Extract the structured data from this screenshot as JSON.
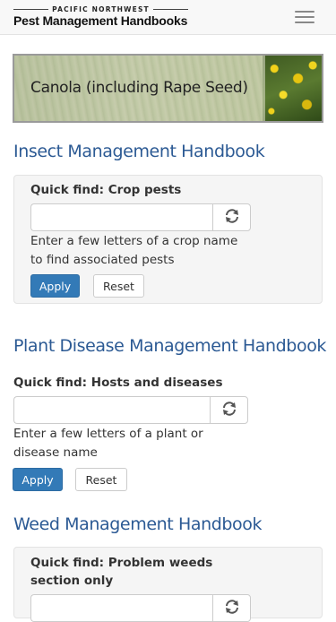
{
  "header": {
    "logo_top": "PACIFIC NORTHWEST",
    "logo_bottom": "Pest Management Handbooks",
    "menu_icon": "hamburger-menu-icon"
  },
  "banner": {
    "title": "Canola (including Rape Seed)"
  },
  "sections": {
    "insect": {
      "title": "Insect Management Handbook",
      "label": "Quick find: Crop pests",
      "input_value": "",
      "help": [
        "Enter a few letters of a crop name",
        "to find associated pests"
      ],
      "apply": "Apply",
      "reset": "Reset",
      "refresh_icon": "refresh-icon"
    },
    "disease": {
      "title": "Plant Disease Management Handbook",
      "label": "Quick find: Hosts and diseases",
      "input_value": "",
      "help": [
        "Enter a few letters of a plant or",
        "disease name"
      ],
      "apply": "Apply",
      "reset": "Reset",
      "refresh_icon": "refresh-icon"
    },
    "weed": {
      "title": "Weed Management Handbook",
      "label": [
        "Quick find: Problem weeds",
        "section only"
      ],
      "input_value": "",
      "refresh_icon": "refresh-icon"
    }
  },
  "colors": {
    "link_blue": "#2c5a94",
    "primary": "#337ab7",
    "well_bg": "#f5f5f5"
  }
}
